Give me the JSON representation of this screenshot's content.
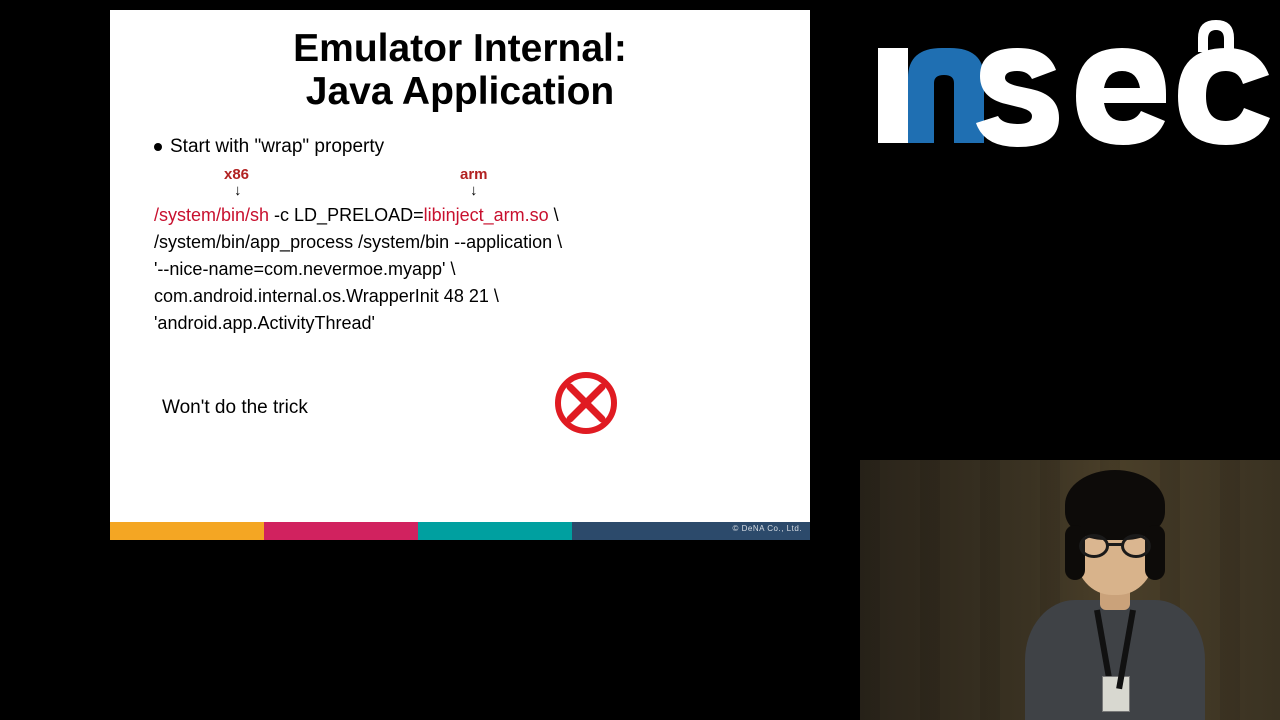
{
  "slide": {
    "title_line1": "Emulator Internal:",
    "title_line2": "Java Application",
    "bullet1": "Start with \"wrap\" property",
    "arch": {
      "x86": "x86",
      "arm": "arm"
    },
    "cmd": {
      "l1_red1": "/system/bin/sh",
      "l1_mid": " -c LD_PRELOAD=",
      "l1_red2": "libinject_arm.so",
      "l1_end": " \\",
      "l2": "/system/bin/app_process /system/bin --application \\",
      "l3": "'--nice-name=com.nevermoe.myapp' \\",
      "l4": "com.android.internal.os.WrapperInit 48 21 \\",
      "l5": "'android.app.ActivityThread'"
    },
    "bullet2": "Won't do the trick",
    "copyright": "© DeNA Co., Ltd."
  },
  "logo": {
    "text": "nsec"
  },
  "colors": {
    "accent_red": "#c8102e",
    "logo_blue": "#1f6fb2"
  }
}
